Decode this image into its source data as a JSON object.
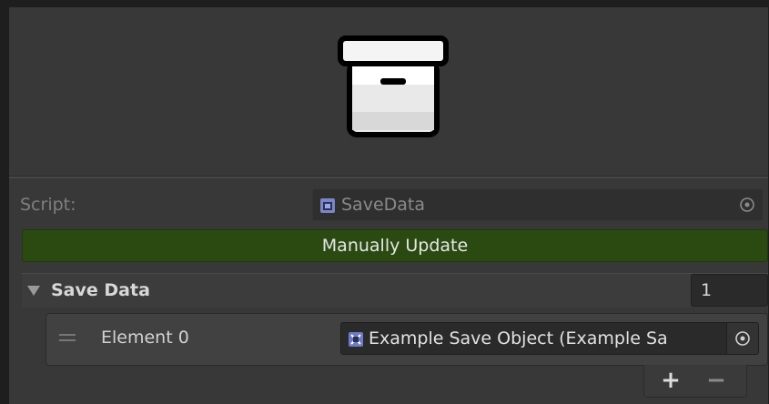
{
  "header": {
    "icon": "storage-box-icon"
  },
  "script_row": {
    "label": "Script:",
    "value": "SaveData",
    "file_icon": "script-file-icon",
    "target_icon": "object-picker-icon"
  },
  "update_button": {
    "label": "Manually Update",
    "color": "#2b4a12"
  },
  "save_data": {
    "title": "Save Data",
    "count": "1",
    "elements": [
      {
        "label": "Element 0",
        "value": "Example Save Object (Example Sa",
        "icon": "scriptable-object-icon"
      }
    ],
    "add_label": "+",
    "remove_label": "−"
  }
}
